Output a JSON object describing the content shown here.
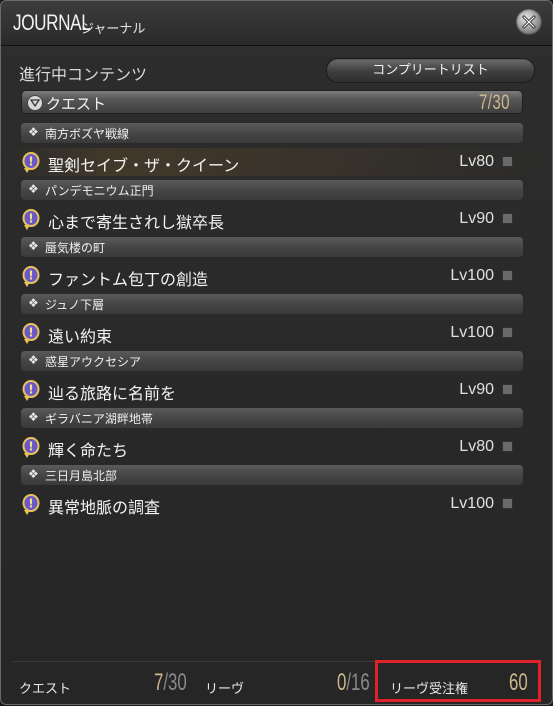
{
  "window": {
    "title_en": "JOURNAL",
    "title_ja": "ジャーナル",
    "close_icon": "close-x-icon"
  },
  "content": {
    "section_label": "進行中コンテンツ",
    "complete_list_button": "コンプリートリスト"
  },
  "quest_header": {
    "label": "クエスト",
    "count": "7/30"
  },
  "groups": [
    {
      "area": "南方ボズヤ戦線",
      "quest": "聖剣セイブ・ザ・クイーン",
      "level": "Lv80",
      "highlighted": true
    },
    {
      "area": "パンデモニウム正門",
      "quest": "心まで寄生されし獄卒長",
      "level": "Lv90",
      "highlighted": false
    },
    {
      "area": "蜃気楼の町",
      "quest": "ファントム包丁の創造",
      "level": "Lv100",
      "highlighted": false
    },
    {
      "area": "ジュノ下層",
      "quest": "遠い約束",
      "level": "Lv100",
      "highlighted": false
    },
    {
      "area": "惑星アウクセシア",
      "quest": "辿る旅路に名前を",
      "level": "Lv90",
      "highlighted": false
    },
    {
      "area": "ギラバニア湖畔地帯",
      "quest": "輝く命たち",
      "level": "Lv80",
      "highlighted": false
    },
    {
      "area": "三日月島北部",
      "quest": "異常地脈の調査",
      "level": "Lv100",
      "highlighted": false
    }
  ],
  "footer": {
    "quest_label": "クエスト",
    "quest_current": "7",
    "quest_max": "/30",
    "leve_label": "リーヴ",
    "leve_current": "0",
    "leve_max": "/16",
    "allowance_label": "リーヴ受注権",
    "allowance_value": "60"
  },
  "colors": {
    "accent_gold": "#cdb88a",
    "highlight_box": "#e0202a"
  }
}
